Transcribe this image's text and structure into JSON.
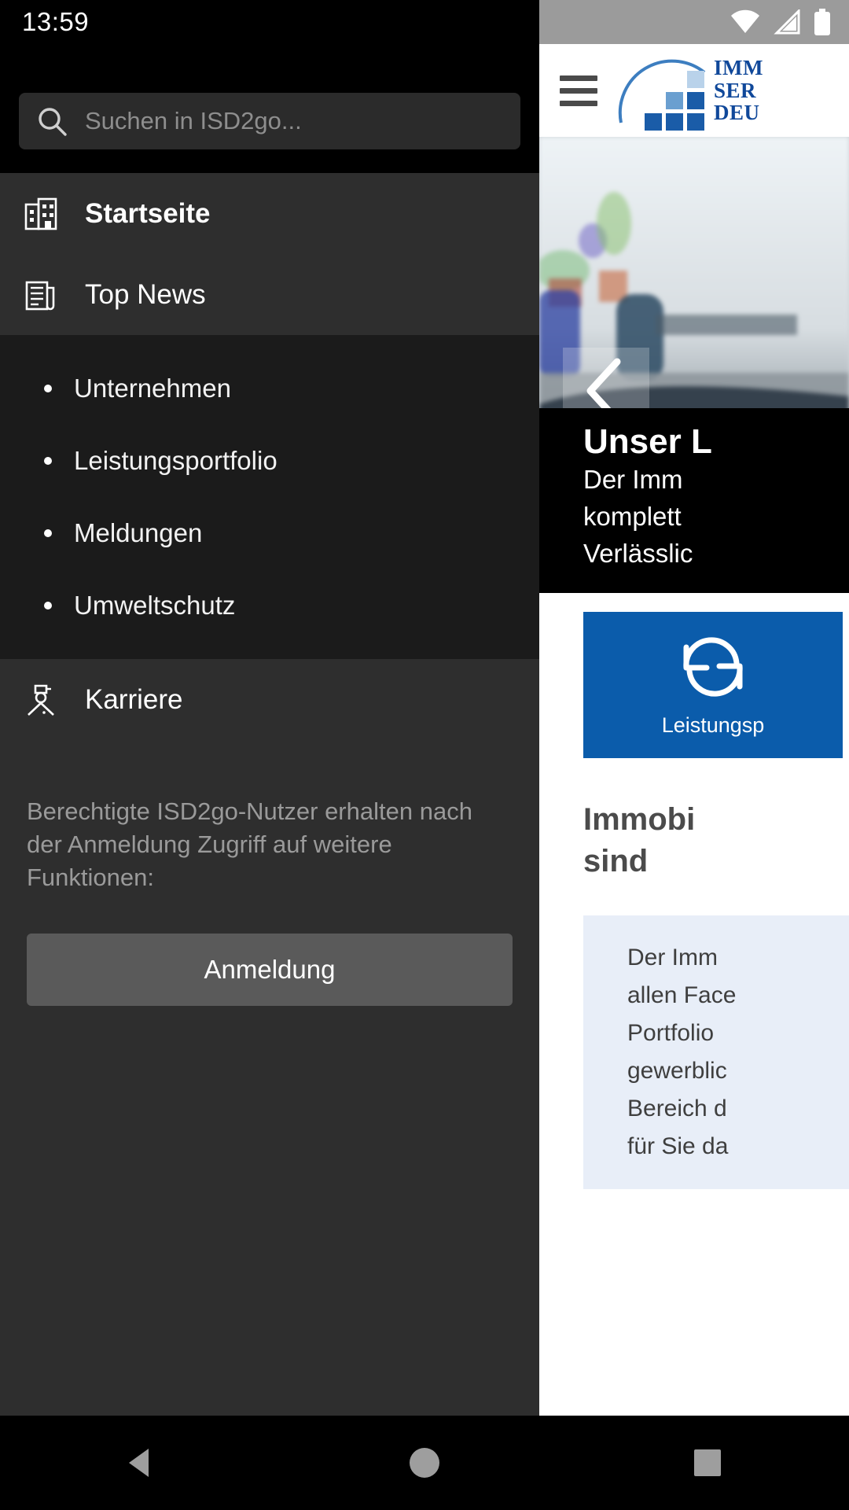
{
  "status_bar": {
    "clock": "13:59",
    "icons": [
      "wifi-icon",
      "cellular-signal-icon",
      "battery-icon"
    ]
  },
  "drawer": {
    "search": {
      "placeholder": "Suchen in ISD2go...",
      "value": "",
      "icon": "search-icon"
    },
    "menu_items": [
      {
        "label": "Startseite",
        "icon": "building-icon",
        "active": true
      },
      {
        "label": "Top News",
        "icon": "newspaper-icon",
        "active": false
      }
    ],
    "sub_items": [
      {
        "label": "Unternehmen"
      },
      {
        "label": "Leistungsportfolio"
      },
      {
        "label": "Meldungen"
      },
      {
        "label": "Umweltschutz"
      }
    ],
    "tail_items": [
      {
        "label": "Karriere",
        "icon": "person-cap-icon",
        "active": false
      }
    ],
    "login_note": "Berechtigte ISD2go-Nutzer erhalten nach der Anmeldung Zugriff auf weitere Funktionen:",
    "login_button": "Anmeldung"
  },
  "page": {
    "header": {
      "menu_icon": "hamburger-icon",
      "logo_lines": [
        "IMM",
        "SER",
        "DEU"
      ]
    },
    "hero": {
      "prev_icon": "chevron-left-icon",
      "title": "Unser L",
      "lines": [
        "Der Imm",
        "komplett",
        "Verlässlic"
      ]
    },
    "tile": {
      "icon": "sync-refresh-icon",
      "label": "Leistungsp"
    },
    "article": {
      "title_lines": [
        "Immobi",
        "sind"
      ],
      "quote_lines": [
        "Der Imm",
        "allen Face",
        "Portfolio",
        "gewerblic",
        "Bereich d",
        "für Sie da"
      ]
    },
    "colors": {
      "brand_blue": "#0b5cab",
      "logo_blue": "#10489a",
      "quote_bg": "#e8eef8"
    }
  },
  "navigation_bar": {
    "buttons": [
      {
        "name": "back-button",
        "icon": "triangle-back-icon"
      },
      {
        "name": "home-button",
        "icon": "circle-home-icon"
      },
      {
        "name": "recents-button",
        "icon": "square-recents-icon"
      }
    ]
  }
}
